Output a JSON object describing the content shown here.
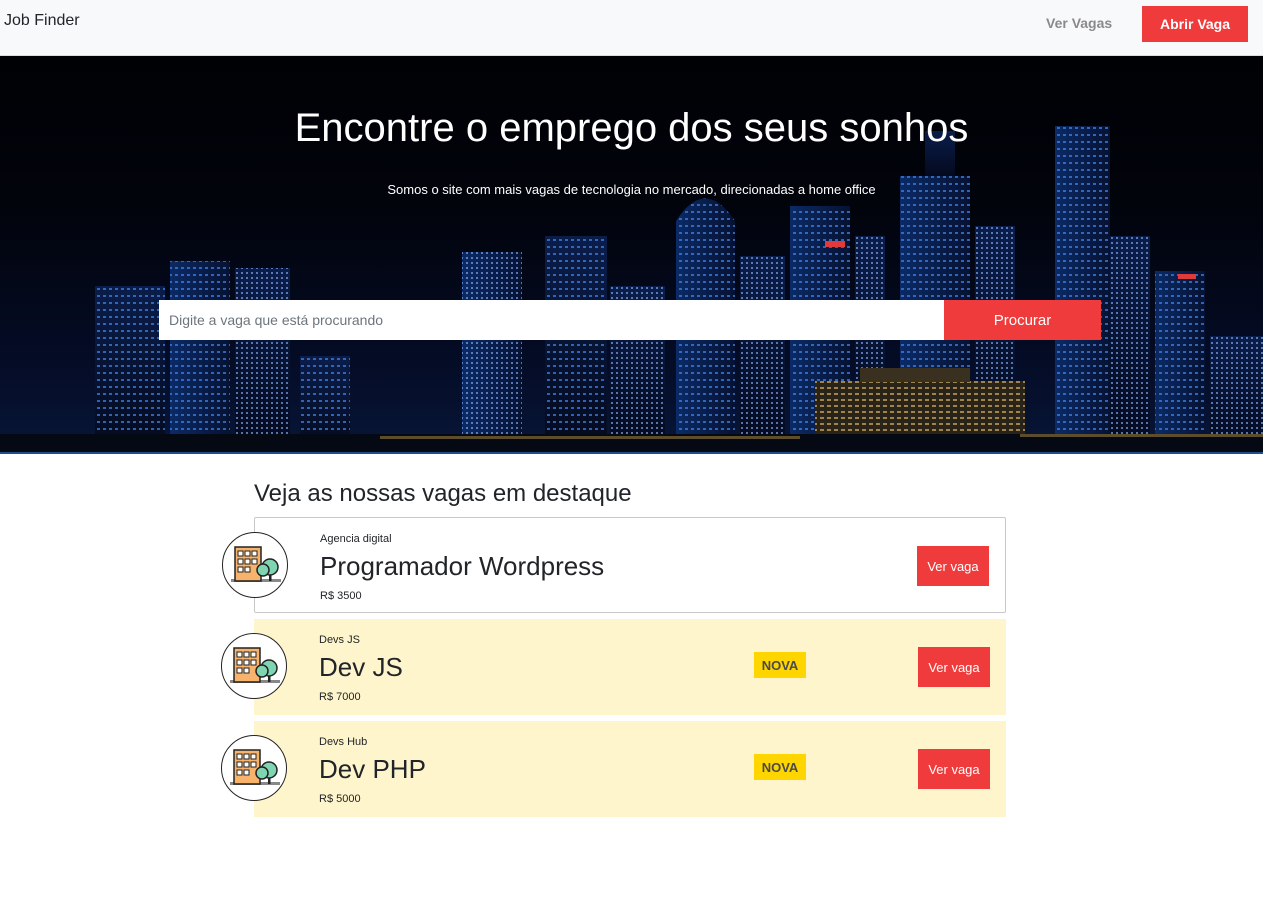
{
  "navbar": {
    "brand": "Job Finder",
    "link": "Ver Vagas",
    "cta": "Abrir Vaga"
  },
  "hero": {
    "title": "Encontre o emprego dos seus sonhos",
    "subtitle": "Somos o site com mais vagas de tecnologia no mercado, direcionadas a home office",
    "search_placeholder": "Digite a vaga que está procurando",
    "search_button": "Procurar"
  },
  "featured": {
    "heading": "Veja as nossas vagas em destaque",
    "jobs": [
      {
        "company": "Agencia digital",
        "title": "Programador Wordpress",
        "salary": "R$ 3500",
        "button": "Ver vaga"
      },
      {
        "company": "Devs JS",
        "title": "Dev JS",
        "salary": "R$ 7000",
        "badge": "NOVA",
        "button": "Ver vaga"
      },
      {
        "company": "Devs Hub",
        "title": "Dev PHP",
        "salary": "R$ 5000",
        "badge": "NOVA",
        "button": "Ver vaga"
      }
    ]
  },
  "colors": {
    "accent": "#ef3b3b",
    "badge": "#ffd500",
    "new_job_bg": "#fff5cc"
  },
  "icons": {
    "company_logo": "building-tree-icon"
  }
}
